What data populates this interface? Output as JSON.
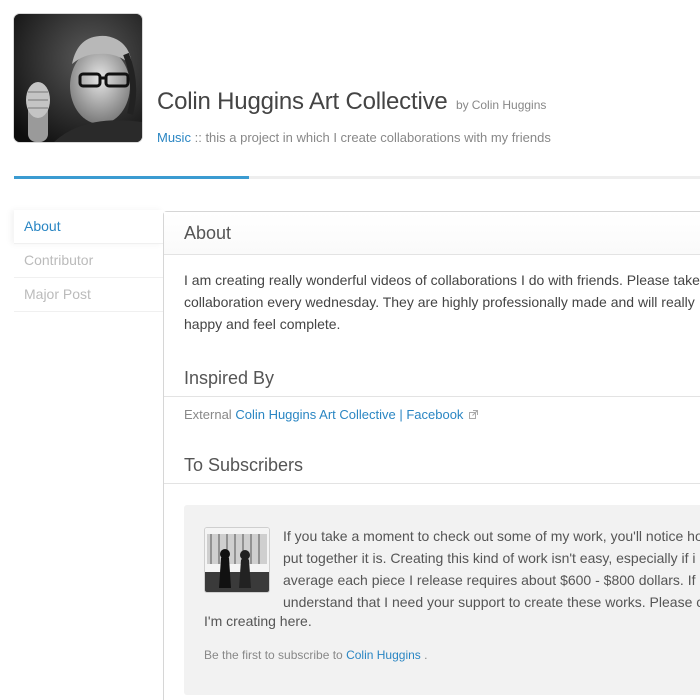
{
  "header": {
    "title": "Colin Huggins Art Collective",
    "by_label": "by",
    "creator": "Colin Huggins",
    "category_link": "Music",
    "separator": "::",
    "tagline": "this a project in which I create collaborations with my friends"
  },
  "sidebar": {
    "items": [
      {
        "label": "About",
        "active": true
      },
      {
        "label": "Contributor",
        "active": false
      },
      {
        "label": "Major Post",
        "active": false
      }
    ]
  },
  "about": {
    "heading": "About",
    "lines": [
      "I am creating really wonderful videos of collaborations I do with friends. Please take",
      "collaboration every wednesday. They are highly professionally made and will really",
      "happy and feel complete."
    ]
  },
  "inspired": {
    "heading": "Inspired By",
    "prefix": "External",
    "link": "Colin Huggins Art Collective | Facebook"
  },
  "subscribers": {
    "heading": "To Subscribers",
    "lines": [
      "If you take a moment to check out some of my work, you'll notice ho",
      "put together it is. Creating this kind of work isn't easy, especially if i",
      "average each piece I release requires about $600 - $800 dollars. If",
      "understand that I need your support to create these works. Please c"
    ],
    "last_line": "I'm creating here.",
    "cta_prefix": "Be the first to subscribe to",
    "cta_link": "Colin Huggins",
    "cta_suffix": "."
  },
  "colors": {
    "accent": "#3b9bd1",
    "link": "#2a86c3",
    "muted": "#888888",
    "box_bg": "#f2f2f2"
  },
  "icons": {
    "external": "external-link-icon"
  }
}
